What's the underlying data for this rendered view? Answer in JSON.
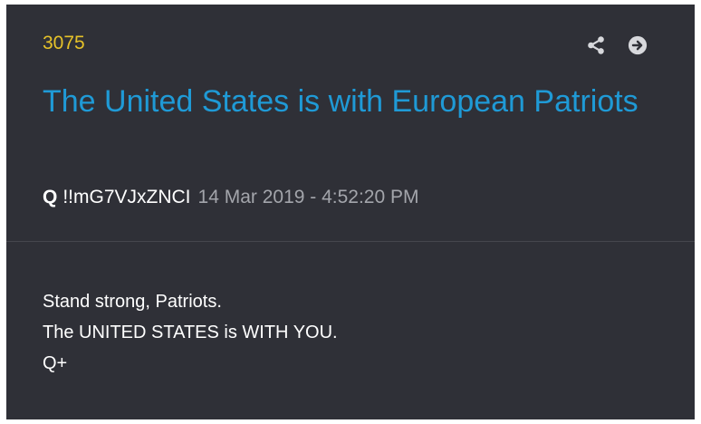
{
  "post": {
    "number": "3075",
    "title": "The United States is with European Patriots",
    "author": "Q",
    "tripcode": "!!mG7VJxZNCI",
    "timestamp": "14 Mar 2019 - 4:52:20 PM",
    "body_lines": [
      "Stand strong, Patriots.",
      "The UNITED STATES is WITH YOU.",
      "Q+"
    ]
  },
  "actions": {
    "share_icon": "share-icon",
    "open_icon": "arrow-right-circle-icon"
  },
  "colors": {
    "card_background": "#2f3037",
    "post_number": "#e6c229",
    "title": "#1f9ad6",
    "timestamp": "#a3a5ab",
    "icons": "#d7d8dc"
  }
}
